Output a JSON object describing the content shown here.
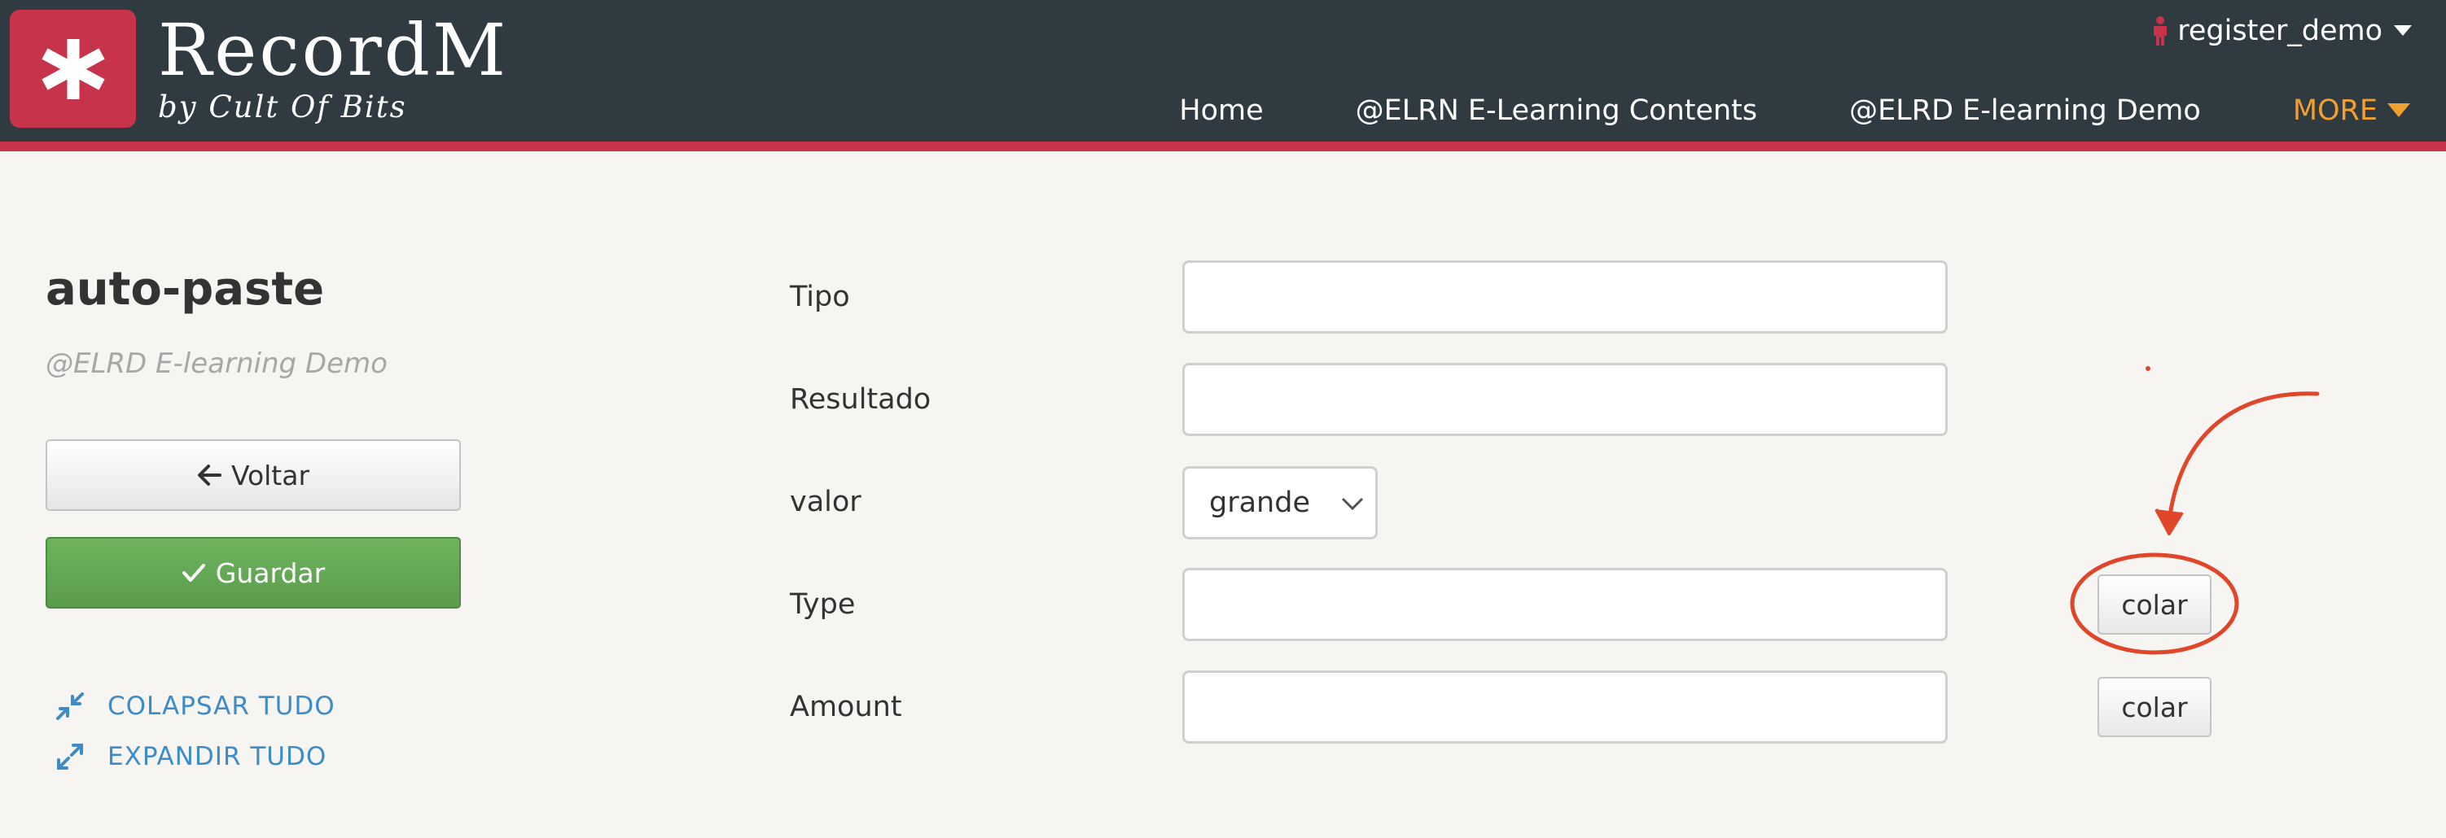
{
  "brand": {
    "name": "RecordM",
    "subtitle": "by Cult Of Bits"
  },
  "user": {
    "name": "register_demo"
  },
  "nav": {
    "items": [
      "Home",
      "@ELRN E-Learning Contents",
      "@ELRD E-learning Demo"
    ],
    "more_label": "MORE"
  },
  "page": {
    "title": "auto-paste",
    "subtitle": "@ELRD E-learning Demo"
  },
  "actions": {
    "back_label": "Voltar",
    "save_label": "Guardar",
    "collapse_label": "COLAPSAR TUDO",
    "expand_label": "EXPANDIR TUDO"
  },
  "form": {
    "fields": [
      {
        "label": "Tipo",
        "value": ""
      },
      {
        "label": "Resultado",
        "value": ""
      },
      {
        "label": "valor",
        "value": "grande"
      },
      {
        "label": "Type",
        "value": "",
        "paste_label": "colar"
      },
      {
        "label": "Amount",
        "value": "",
        "paste_label": "colar"
      }
    ]
  },
  "colors": {
    "header_bg": "#2f3b41",
    "brand_red": "#c8334c",
    "more_orange": "#f0a030",
    "save_green": "#5fa652",
    "link_blue": "#3d8cc8",
    "annotation": "#e0462a"
  }
}
